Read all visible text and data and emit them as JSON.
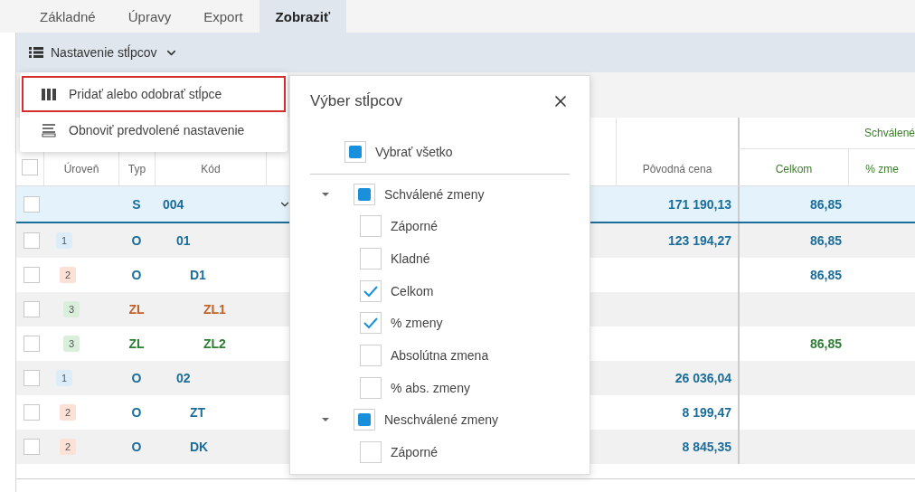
{
  "tabs": [
    {
      "label": "Základné",
      "selected": false
    },
    {
      "label": "Úpravy",
      "selected": false
    },
    {
      "label": "Export",
      "selected": false
    },
    {
      "label": "Zobraziť",
      "selected": true
    }
  ],
  "toolbar": {
    "columns_button": "Nastavenie stĺpcov"
  },
  "columns_menu": {
    "items": [
      {
        "label": "Pridať alebo odobrať stĺpce",
        "selected": true,
        "kind": "columns"
      },
      {
        "label": "Obnoviť predvolené nastavenie",
        "selected": false,
        "kind": "reset"
      }
    ]
  },
  "table": {
    "select_all_checked": false,
    "group_header": "Schválené",
    "columns": [
      "Úroveň",
      "Typ",
      "Kód",
      "Pôvodná cena",
      "Celkom",
      "% zme"
    ],
    "rows": [
      {
        "kind": "summary",
        "checked": false,
        "type": "S",
        "code": "004",
        "original_price": "171 190,13",
        "total": "86,85",
        "color": "#1b6d9a",
        "children": [
          {
            "kind": "item",
            "checked": false,
            "badge": {
              "text": "1",
              "color": "#dcedf9"
            },
            "type": "O",
            "code": "01",
            "original_price": "123 194,27",
            "total": "86,85",
            "color": "#1b6d9a",
            "children": [
              {
                "kind": "item",
                "checked": false,
                "badge": {
                  "text": "2",
                  "color": "#fbe1d6"
                },
                "type": "O",
                "code": "D1",
                "total": "86,85",
                "color": "#1b6d9a",
                "children": [
                  {
                    "kind": "item",
                    "checked": false,
                    "badge": {
                      "text": "3",
                      "color": "#d9efdc"
                    },
                    "type": "ZL",
                    "code": "ZL1",
                    "color": "#c0622b"
                  },
                  {
                    "kind": "item",
                    "checked": false,
                    "badge": {
                      "text": "3",
                      "color": "#d9efdc"
                    },
                    "type": "ZL",
                    "code": "ZL2",
                    "total": "86,85",
                    "color": "#2e7d32"
                  }
                ]
              }
            ]
          },
          {
            "kind": "item",
            "checked": false,
            "badge": {
              "text": "1",
              "color": "#dcedf9"
            },
            "type": "O",
            "code": "02",
            "original_price": "26 036,04",
            "color": "#1b6d9a",
            "children": [
              {
                "kind": "item",
                "checked": false,
                "badge": {
                  "text": "2",
                  "color": "#fbe1d6"
                },
                "type": "O",
                "code": "ZT",
                "original_price": "8 199,47",
                "color": "#1b6d9a"
              },
              {
                "kind": "item",
                "checked": false,
                "badge": {
                  "text": "2",
                  "color": "#fbe1d6"
                },
                "type": "O",
                "code": "DK",
                "original_price": "8 845,35",
                "color": "#1b6d9a"
              }
            ]
          }
        ]
      }
    ]
  },
  "column_picker": {
    "title": "Výber stĺpcov",
    "select_all": {
      "label": "Vybrať všetko",
      "checked": false,
      "indeterminate": true
    },
    "groups": [
      {
        "label": "Schválené zmeny",
        "expanded": true,
        "checked": false,
        "indeterminate": true,
        "children": [
          {
            "label": "Záporné",
            "checked": false
          },
          {
            "label": "Kladné",
            "checked": false
          },
          {
            "label": "Celkom",
            "checked": true
          },
          {
            "label": "% zmeny",
            "checked": true
          },
          {
            "label": "Absolútna zmena",
            "checked": false
          },
          {
            "label": "% abs. zmeny",
            "checked": false
          }
        ]
      },
      {
        "label": "Neschválené zmeny",
        "expanded": true,
        "checked": false,
        "indeterminate": true,
        "children": [
          {
            "label": "Záporné",
            "checked": false
          }
        ]
      }
    ]
  }
}
